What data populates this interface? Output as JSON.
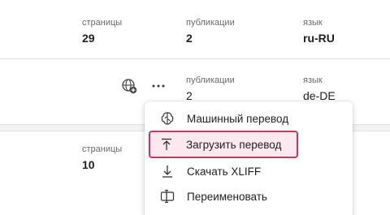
{
  "rows": [
    {
      "pages_label": "страницы",
      "pages_value": "29",
      "pubs_label": "публикации",
      "pubs_value": "2",
      "lang_label": "язык",
      "lang_value": "ru-RU"
    },
    {
      "pubs_label": "публикации",
      "pubs_value": "2",
      "lang_label": "язык",
      "lang_value": "de-DE"
    },
    {
      "pages_label": "страницы",
      "pages_value": "10"
    }
  ],
  "menu": {
    "items": [
      {
        "label": "Машинный перевод",
        "icon": "brain-icon"
      },
      {
        "label": "Загрузить перевод",
        "icon": "upload-icon",
        "active": true
      },
      {
        "label": "Скачать XLIFF",
        "icon": "download-icon"
      },
      {
        "label": "Переименовать",
        "icon": "rename-icon"
      }
    ]
  },
  "colors": {
    "accent": "#d1305f",
    "active_bg": "#fbe9ef"
  }
}
